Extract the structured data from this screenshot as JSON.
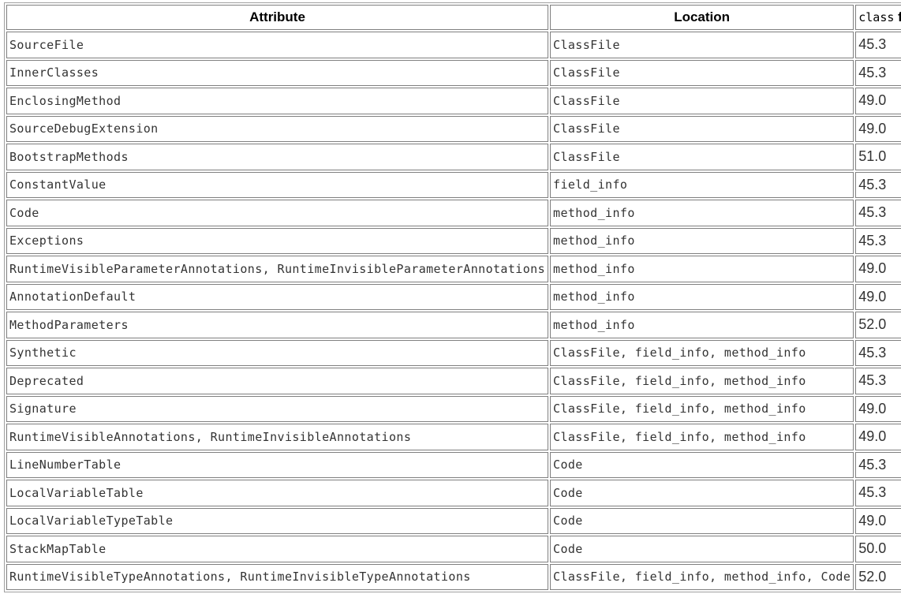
{
  "table": {
    "headers": {
      "attribute": "Attribute",
      "location": "Location",
      "class_file_code": "class",
      "class_file_rest": " file"
    },
    "rows": [
      {
        "attribute": "SourceFile",
        "location": "ClassFile",
        "version": "45.3"
      },
      {
        "attribute": "InnerClasses",
        "location": "ClassFile",
        "version": "45.3"
      },
      {
        "attribute": "EnclosingMethod",
        "location": "ClassFile",
        "version": "49.0"
      },
      {
        "attribute": "SourceDebugExtension",
        "location": "ClassFile",
        "version": "49.0"
      },
      {
        "attribute": "BootstrapMethods",
        "location": "ClassFile",
        "version": "51.0"
      },
      {
        "attribute": "ConstantValue",
        "location": "field_info",
        "version": "45.3"
      },
      {
        "attribute": "Code",
        "location": "method_info",
        "version": "45.3"
      },
      {
        "attribute": "Exceptions",
        "location": "method_info",
        "version": "45.3"
      },
      {
        "attribute": "RuntimeVisibleParameterAnnotations, RuntimeInvisibleParameterAnnotations",
        "location": "method_info",
        "version": "49.0"
      },
      {
        "attribute": "AnnotationDefault",
        "location": "method_info",
        "version": "49.0"
      },
      {
        "attribute": "MethodParameters",
        "location": "method_info",
        "version": "52.0"
      },
      {
        "attribute": "Synthetic",
        "location": "ClassFile, field_info, method_info",
        "version": "45.3"
      },
      {
        "attribute": "Deprecated",
        "location": "ClassFile, field_info, method_info",
        "version": "45.3"
      },
      {
        "attribute": "Signature",
        "location": "ClassFile, field_info, method_info",
        "version": "49.0"
      },
      {
        "attribute": "RuntimeVisibleAnnotations, RuntimeInvisibleAnnotations",
        "location": "ClassFile, field_info, method_info",
        "version": "49.0"
      },
      {
        "attribute": "LineNumberTable",
        "location": "Code",
        "version": "45.3"
      },
      {
        "attribute": "LocalVariableTable",
        "location": "Code",
        "version": "45.3"
      },
      {
        "attribute": "LocalVariableTypeTable",
        "location": "Code",
        "version": "49.0"
      },
      {
        "attribute": "StackMapTable",
        "location": "Code",
        "version": "50.0"
      },
      {
        "attribute": "RuntimeVisibleTypeAnnotations, RuntimeInvisibleTypeAnnotations",
        "location": "ClassFile, field_info, method_info, Code",
        "version": "52.0"
      }
    ]
  }
}
